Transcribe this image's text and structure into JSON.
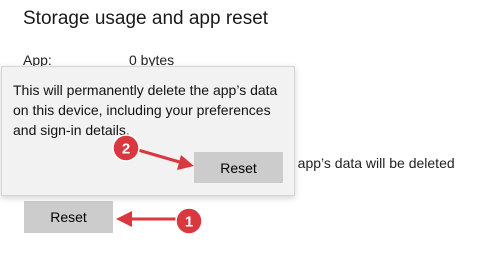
{
  "section": {
    "title": "Storage usage and app reset",
    "app_label": "App:",
    "app_value": "0 bytes",
    "reset_description_tail": "e app’s data will be deleted",
    "reset_button_label": "Reset"
  },
  "flyout": {
    "message": "This will permanently delete the app’s data on this device, including your preferences and sign-in details.",
    "confirm_button_label": "Reset"
  },
  "annotations": {
    "color": "#d9383f",
    "step1": "1",
    "step2": "2"
  }
}
